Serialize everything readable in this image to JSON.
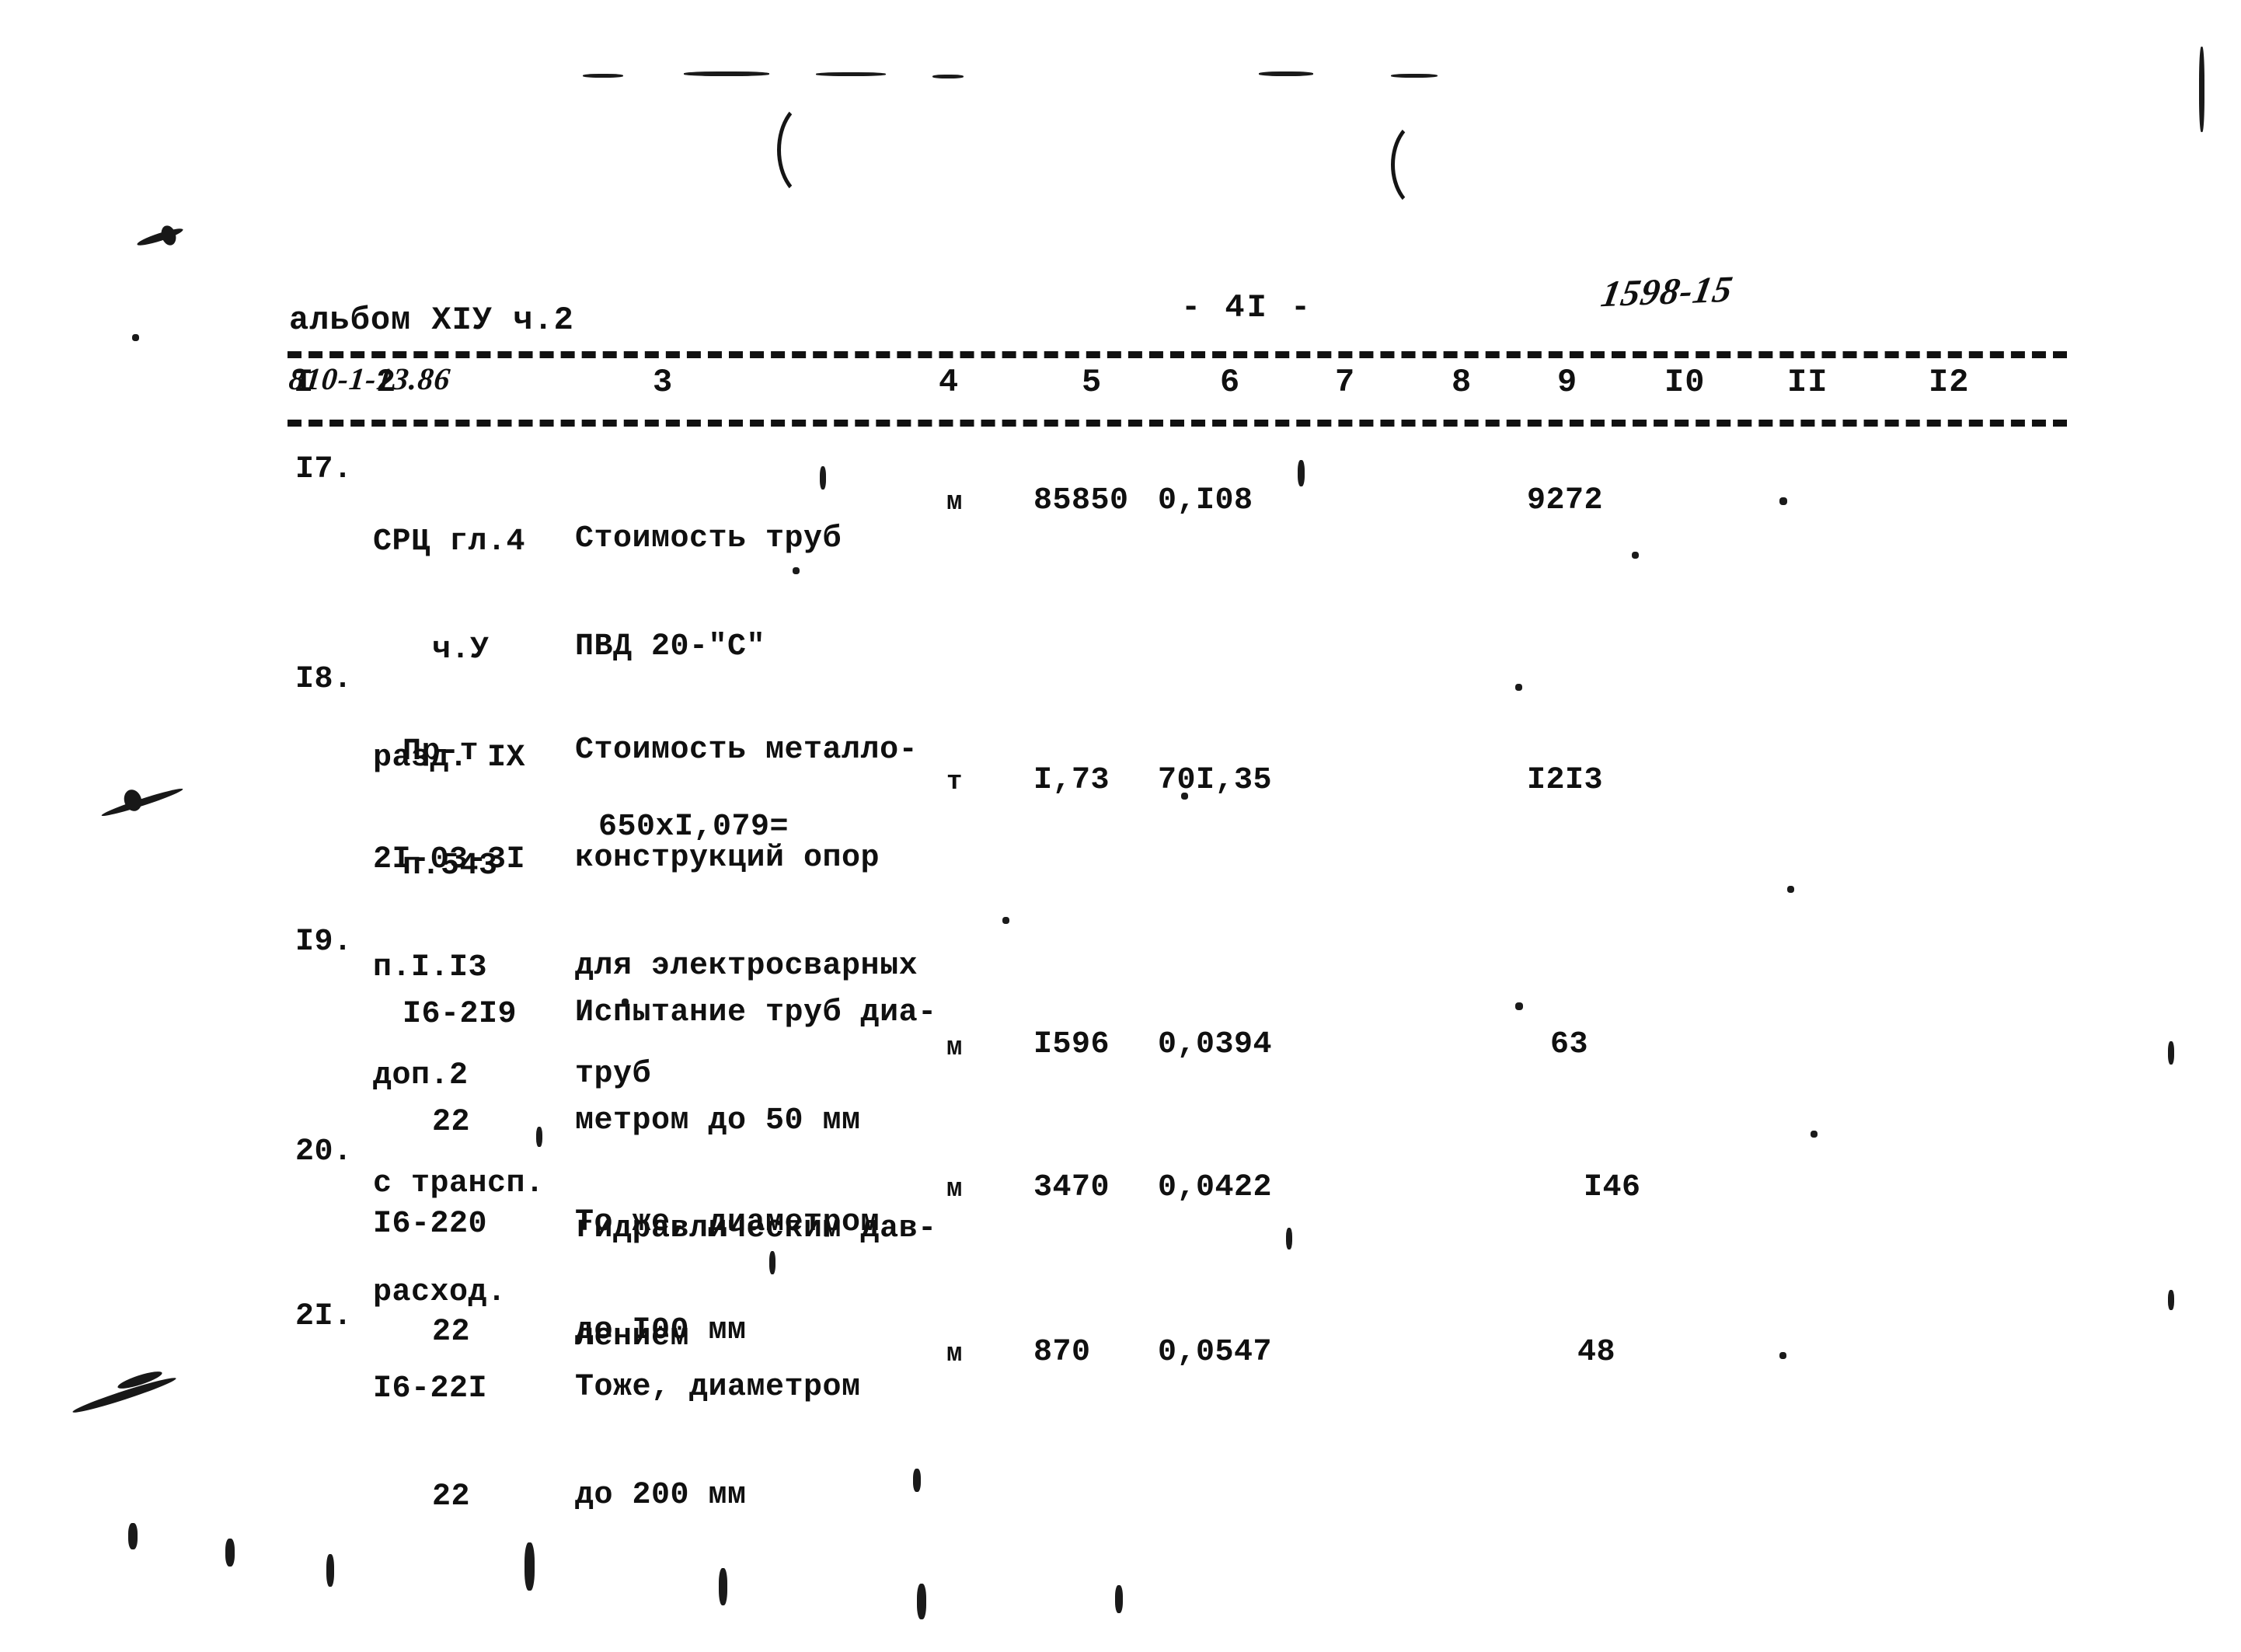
{
  "document": {
    "album_title": "альбом XIУ ч.2",
    "album_code": "810-1-13.86",
    "page_number": "- 4I -",
    "hand_note": "1598-15"
  },
  "table": {
    "column_headers": [
      "I",
      "2",
      "3",
      "4",
      "5",
      "6",
      "7",
      "8",
      "9",
      "I0",
      "II",
      "I2"
    ],
    "rows": [
      {
        "num": "I7.",
        "code_lines": [
          "СРЦ гл.4",
          "ч.У",
          "разд. IX",
          "п.543"
        ],
        "desc_lines": [
          "Стоимость труб",
          "ПВД 20-\"С\""
        ],
        "unit": "м",
        "qty": "85850",
        "price": "0,I08",
        "total": "9272"
      },
      {
        "num": "I8.",
        "code_lines": [
          "Пр-т",
          "2I-03-3I",
          "п.I.I3",
          "доп.2",
          "с трансп.",
          "расход."
        ],
        "desc_lines": [
          "Стоимость металло-",
          "конструкций опор",
          "для электросварных",
          "труб"
        ],
        "desc_extra": "650xI,079=",
        "unit": "т",
        "qty": "I,73",
        "price": "70I,35",
        "total": "I2I3"
      },
      {
        "num": "I9.",
        "code_lines": [
          "I6-2I9",
          "22"
        ],
        "desc_lines": [
          "Испытание труб диа-",
          "метром до 50 мм",
          "гидравлическим дав-",
          "лением"
        ],
        "unit": "м",
        "qty": "I596",
        "price": "0,0394",
        "total": "63"
      },
      {
        "num": "20.",
        "code_lines": [
          "I6-220",
          "22"
        ],
        "desc_lines": [
          "То же, диаметром",
          "до I00 мм"
        ],
        "unit": "м",
        "qty": "3470",
        "price": "0,0422",
        "total": "I46"
      },
      {
        "num": "2I.",
        "code_lines": [
          "I6-22I",
          "22"
        ],
        "desc_lines": [
          "Тоже, диаметром",
          "до 200 мм"
        ],
        "unit": "м",
        "qty": "870",
        "price": "0,0547",
        "total": "48"
      }
    ]
  }
}
